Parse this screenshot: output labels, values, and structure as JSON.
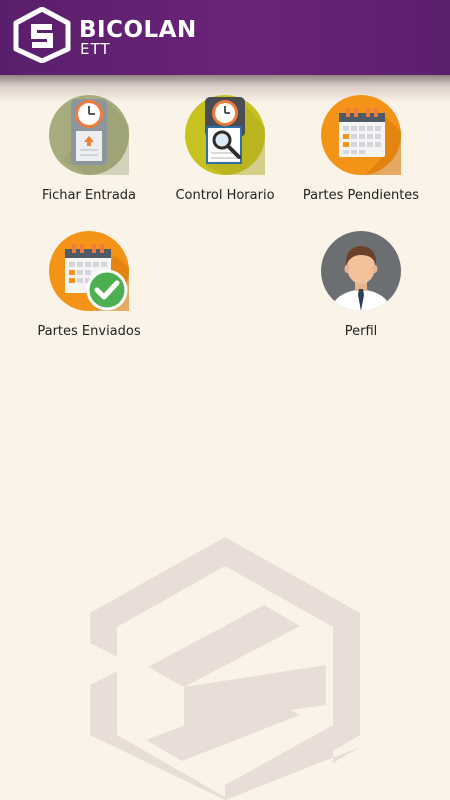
{
  "app": {
    "brand_name": "BICOLAN",
    "brand_sub": "ETT",
    "colors": {
      "header": "#5A1F6B",
      "background": "#FAF3E8",
      "accent_orange": "#F39418",
      "check_green": "#4CAF50"
    }
  },
  "menu": {
    "items": [
      {
        "label": "Fichar Entrada",
        "icon": "clock-in-icon"
      },
      {
        "label": "Control Horario",
        "icon": "clock-search-icon"
      },
      {
        "label": "Partes Pendientes",
        "icon": "calendar-icon"
      },
      {
        "label": "Partes Enviados",
        "icon": "calendar-check-icon"
      },
      {
        "label": "Perfil",
        "icon": "user-avatar-icon"
      }
    ]
  }
}
